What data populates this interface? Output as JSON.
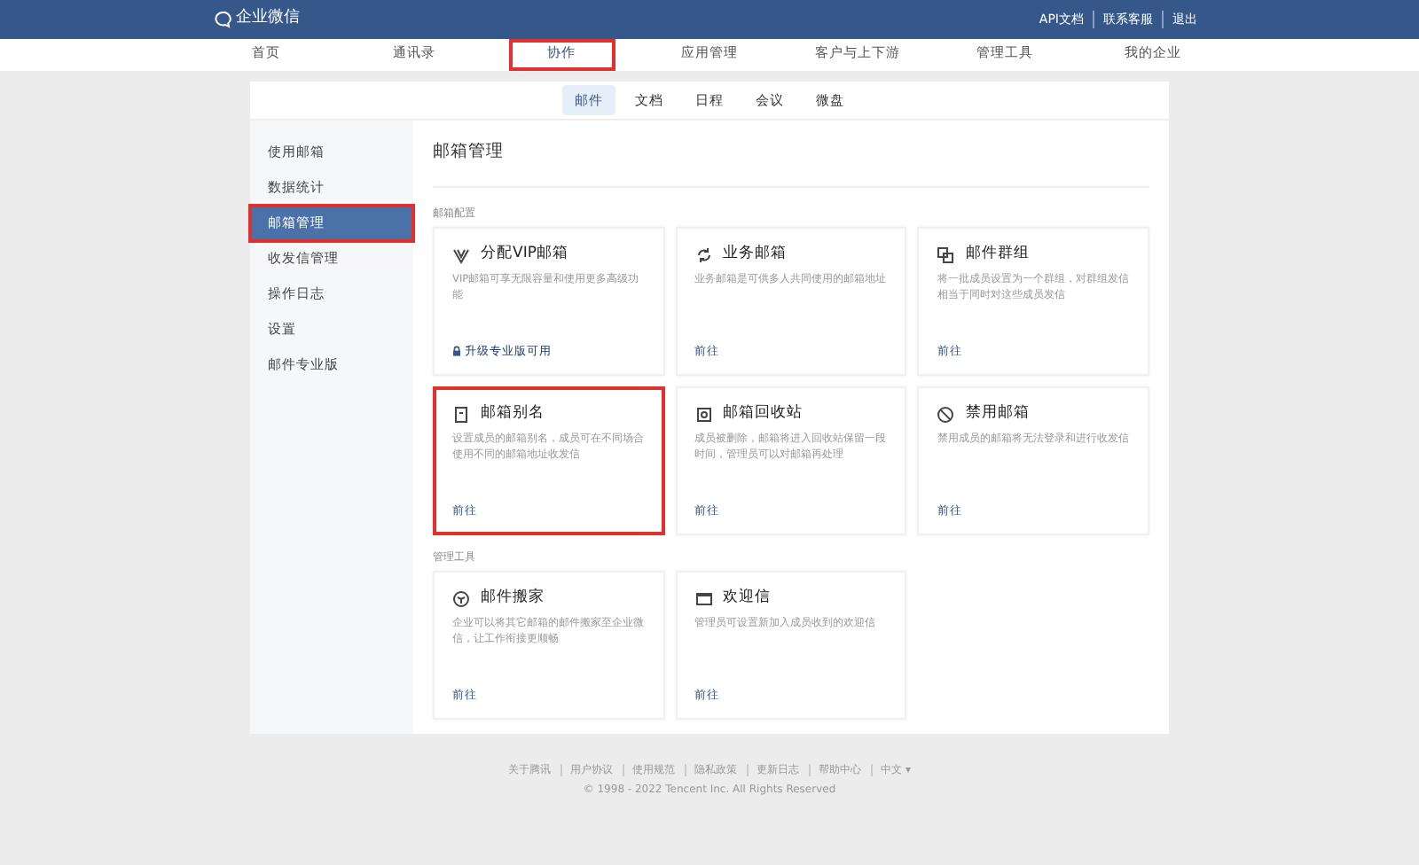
{
  "header": {
    "logo": "企业微信",
    "links": [
      "API文档",
      "联系客服",
      "退出"
    ]
  },
  "nav": [
    {
      "label": "首页",
      "selected": false,
      "highlighted": false
    },
    {
      "label": "通讯录",
      "selected": false,
      "highlighted": false
    },
    {
      "label": "协作",
      "selected": true,
      "highlighted": true
    },
    {
      "label": "应用管理",
      "selected": false,
      "highlighted": false
    },
    {
      "label": "客户与上下游",
      "selected": false,
      "highlighted": false
    },
    {
      "label": "管理工具",
      "selected": false,
      "highlighted": false
    },
    {
      "label": "我的企业",
      "selected": false,
      "highlighted": false
    }
  ],
  "subtabs": [
    {
      "label": "邮件",
      "selected": true
    },
    {
      "label": "文档",
      "selected": false
    },
    {
      "label": "日程",
      "selected": false
    },
    {
      "label": "会议",
      "selected": false
    },
    {
      "label": "微盘",
      "selected": false
    }
  ],
  "sidebar": {
    "items": [
      {
        "label": "使用邮箱",
        "selected": false,
        "highlighted": false
      },
      {
        "label": "数据统计",
        "selected": false,
        "highlighted": false
      },
      {
        "label": "邮箱管理",
        "selected": true,
        "highlighted": true
      },
      {
        "label": "收发信管理",
        "selected": false,
        "highlighted": false
      },
      {
        "label": "操作日志",
        "selected": false,
        "highlighted": false
      },
      {
        "label": "设置",
        "selected": false,
        "highlighted": false
      },
      {
        "label": "邮件专业版",
        "selected": false,
        "highlighted": false
      }
    ]
  },
  "page_title": "邮箱管理",
  "sections": [
    {
      "title": "邮箱配置",
      "cards": [
        {
          "title": "分配VIP邮箱",
          "description": "VIP邮箱可享无限容量和使用更多高级功能",
          "action": "升级专业版可用",
          "locked": true,
          "highlighted": false
        },
        {
          "title": "业务邮箱",
          "description": "业务邮箱是可供多人共同使用的邮箱地址",
          "action": "前往",
          "locked": false,
          "highlighted": false
        },
        {
          "title": "邮件群组",
          "description": "将一批成员设置为一个群组，对群组发信相当于同时对这些成员发信",
          "action": "前往",
          "locked": false,
          "highlighted": false
        },
        {
          "title": "邮箱别名",
          "description": "设置成员的邮箱别名，成员可在不同场合使用不同的邮箱地址收发信",
          "action": "前往",
          "locked": false,
          "highlighted": true
        },
        {
          "title": "邮箱回收站",
          "description": "成员被删除，邮箱将进入回收站保留一段时间，管理员可以对邮箱再处理",
          "action": "前往",
          "locked": false,
          "highlighted": false
        },
        {
          "title": "禁用邮箱",
          "description": "禁用成员的邮箱将无法登录和进行收发信",
          "action": "前往",
          "locked": false,
          "highlighted": false
        }
      ]
    },
    {
      "title": "管理工具",
      "cards": [
        {
          "title": "邮件搬家",
          "description": "企业可以将其它邮箱的邮件搬家至企业微信，让工作衔接更顺畅",
          "action": "前往",
          "locked": false,
          "highlighted": false
        },
        {
          "title": "欢迎信",
          "description": "管理员可设置新加入成员收到的欢迎信",
          "action": "前往",
          "locked": false,
          "highlighted": false
        }
      ]
    }
  ],
  "footer": {
    "links": [
      "关于腾讯",
      "用户协议",
      "使用规范",
      "隐私政策",
      "更新日志",
      "帮助中心",
      "中文 ▾"
    ],
    "copyright": "© 1998 - 2022 Tencent Inc. All Rights Reserved"
  }
}
